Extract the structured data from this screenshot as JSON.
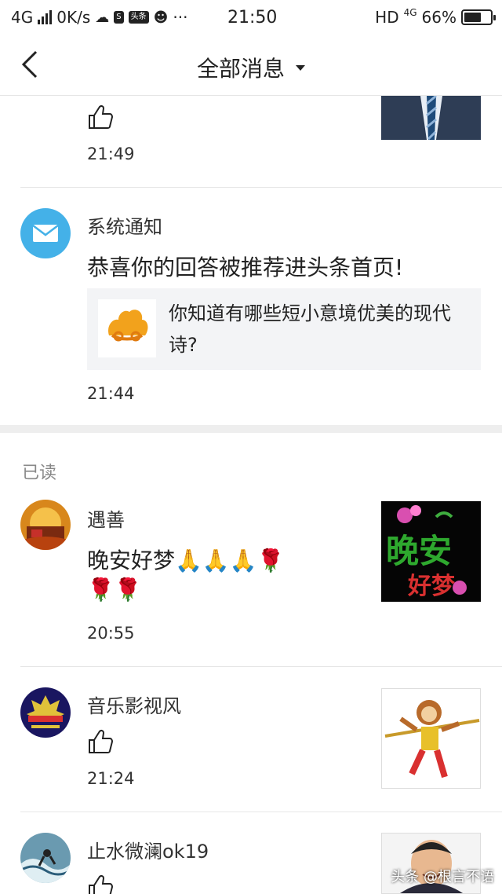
{
  "status_bar": {
    "network": "4G",
    "speed": "0K/s",
    "icon_app1": "头条",
    "more": "···",
    "time": "21:50",
    "hd": "HD",
    "net2": "4G",
    "battery": "66%",
    "battery_level": 0.66
  },
  "nav": {
    "title": "全部消息"
  },
  "messages_top": [
    {
      "time": "21:49"
    },
    {
      "name": "系统通知",
      "content": "恭喜你的回答被推荐进头条首页!",
      "card_text": "你知道有哪些短小意境优美的现代诗?",
      "time": "21:44"
    }
  ],
  "section_label": "已读",
  "messages_read": [
    {
      "name": "遇善",
      "content_line1": "晚安好梦🙏🙏🙏🌹",
      "content_line2": "🌹🌹",
      "time": "20:55",
      "thumb_text1": "晚安",
      "thumb_text2": "好梦"
    },
    {
      "name": "音乐影视风",
      "time": "21:24"
    },
    {
      "name": "止水微澜ok19"
    }
  ],
  "watermark": "头条 @根言不语",
  "colors": {
    "accent_blue": "#44b1e8",
    "divider": "#e6e6e6",
    "card_bg": "#f3f4f6"
  }
}
